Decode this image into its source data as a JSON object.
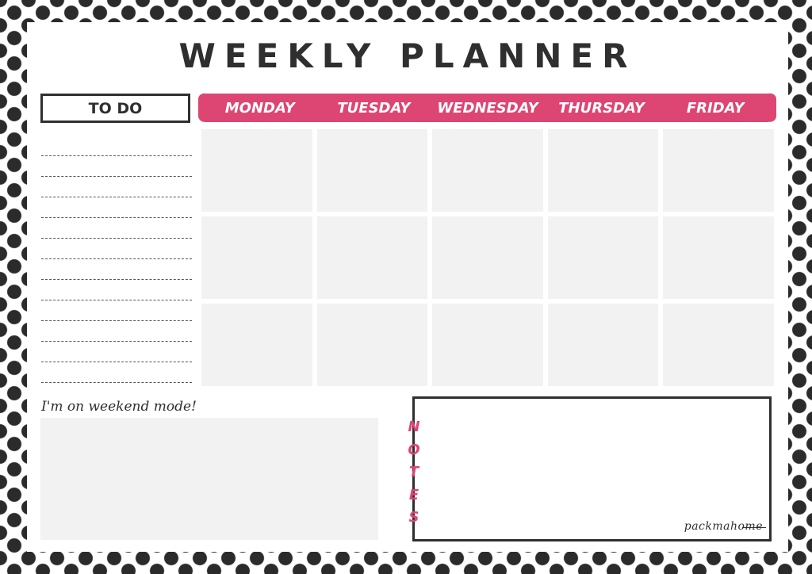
{
  "title": "WEEKLY PLANNER",
  "todo": {
    "header": "TO DO",
    "line_count": 12
  },
  "days": [
    "MONDAY",
    "TUESDAY",
    "WEDNESDAY",
    "THURSDAY",
    "FRIDAY"
  ],
  "weekend": {
    "label": "I'm on weekend mode!"
  },
  "notes": {
    "letters": [
      "N",
      "O",
      "T",
      "E",
      "S"
    ],
    "brand": "packmahome"
  },
  "colors": {
    "accent": "#dd4573",
    "ink": "#2f2f2f",
    "cell": "#f2f2f2"
  }
}
